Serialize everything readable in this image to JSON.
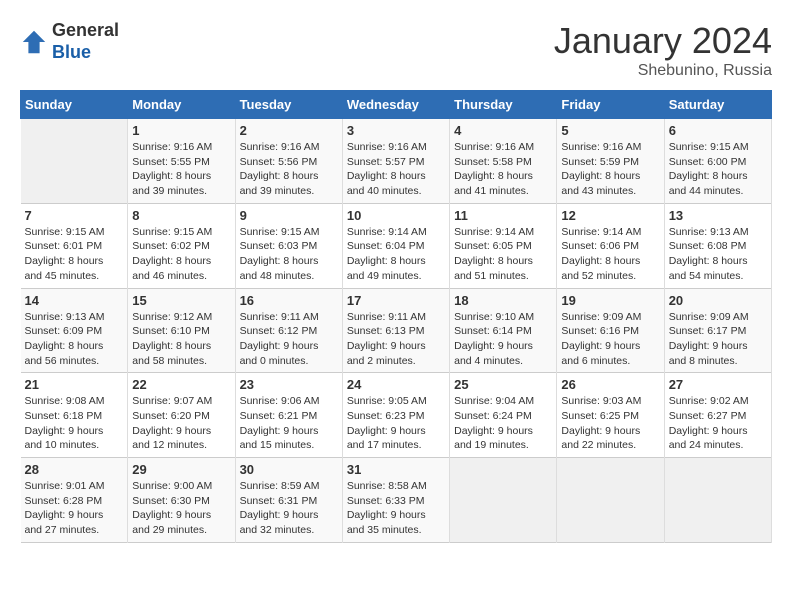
{
  "header": {
    "logo_line1": "General",
    "logo_line2": "Blue",
    "month": "January 2024",
    "location": "Shebunino, Russia"
  },
  "weekdays": [
    "Sunday",
    "Monday",
    "Tuesday",
    "Wednesday",
    "Thursday",
    "Friday",
    "Saturday"
  ],
  "weeks": [
    [
      {
        "num": "",
        "info": ""
      },
      {
        "num": "1",
        "info": "Sunrise: 9:16 AM\nSunset: 5:55 PM\nDaylight: 8 hours\nand 39 minutes."
      },
      {
        "num": "2",
        "info": "Sunrise: 9:16 AM\nSunset: 5:56 PM\nDaylight: 8 hours\nand 39 minutes."
      },
      {
        "num": "3",
        "info": "Sunrise: 9:16 AM\nSunset: 5:57 PM\nDaylight: 8 hours\nand 40 minutes."
      },
      {
        "num": "4",
        "info": "Sunrise: 9:16 AM\nSunset: 5:58 PM\nDaylight: 8 hours\nand 41 minutes."
      },
      {
        "num": "5",
        "info": "Sunrise: 9:16 AM\nSunset: 5:59 PM\nDaylight: 8 hours\nand 43 minutes."
      },
      {
        "num": "6",
        "info": "Sunrise: 9:15 AM\nSunset: 6:00 PM\nDaylight: 8 hours\nand 44 minutes."
      }
    ],
    [
      {
        "num": "7",
        "info": "Sunrise: 9:15 AM\nSunset: 6:01 PM\nDaylight: 8 hours\nand 45 minutes."
      },
      {
        "num": "8",
        "info": "Sunrise: 9:15 AM\nSunset: 6:02 PM\nDaylight: 8 hours\nand 46 minutes."
      },
      {
        "num": "9",
        "info": "Sunrise: 9:15 AM\nSunset: 6:03 PM\nDaylight: 8 hours\nand 48 minutes."
      },
      {
        "num": "10",
        "info": "Sunrise: 9:14 AM\nSunset: 6:04 PM\nDaylight: 8 hours\nand 49 minutes."
      },
      {
        "num": "11",
        "info": "Sunrise: 9:14 AM\nSunset: 6:05 PM\nDaylight: 8 hours\nand 51 minutes."
      },
      {
        "num": "12",
        "info": "Sunrise: 9:14 AM\nSunset: 6:06 PM\nDaylight: 8 hours\nand 52 minutes."
      },
      {
        "num": "13",
        "info": "Sunrise: 9:13 AM\nSunset: 6:08 PM\nDaylight: 8 hours\nand 54 minutes."
      }
    ],
    [
      {
        "num": "14",
        "info": "Sunrise: 9:13 AM\nSunset: 6:09 PM\nDaylight: 8 hours\nand 56 minutes."
      },
      {
        "num": "15",
        "info": "Sunrise: 9:12 AM\nSunset: 6:10 PM\nDaylight: 8 hours\nand 58 minutes."
      },
      {
        "num": "16",
        "info": "Sunrise: 9:11 AM\nSunset: 6:12 PM\nDaylight: 9 hours\nand 0 minutes."
      },
      {
        "num": "17",
        "info": "Sunrise: 9:11 AM\nSunset: 6:13 PM\nDaylight: 9 hours\nand 2 minutes."
      },
      {
        "num": "18",
        "info": "Sunrise: 9:10 AM\nSunset: 6:14 PM\nDaylight: 9 hours\nand 4 minutes."
      },
      {
        "num": "19",
        "info": "Sunrise: 9:09 AM\nSunset: 6:16 PM\nDaylight: 9 hours\nand 6 minutes."
      },
      {
        "num": "20",
        "info": "Sunrise: 9:09 AM\nSunset: 6:17 PM\nDaylight: 9 hours\nand 8 minutes."
      }
    ],
    [
      {
        "num": "21",
        "info": "Sunrise: 9:08 AM\nSunset: 6:18 PM\nDaylight: 9 hours\nand 10 minutes."
      },
      {
        "num": "22",
        "info": "Sunrise: 9:07 AM\nSunset: 6:20 PM\nDaylight: 9 hours\nand 12 minutes."
      },
      {
        "num": "23",
        "info": "Sunrise: 9:06 AM\nSunset: 6:21 PM\nDaylight: 9 hours\nand 15 minutes."
      },
      {
        "num": "24",
        "info": "Sunrise: 9:05 AM\nSunset: 6:23 PM\nDaylight: 9 hours\nand 17 minutes."
      },
      {
        "num": "25",
        "info": "Sunrise: 9:04 AM\nSunset: 6:24 PM\nDaylight: 9 hours\nand 19 minutes."
      },
      {
        "num": "26",
        "info": "Sunrise: 9:03 AM\nSunset: 6:25 PM\nDaylight: 9 hours\nand 22 minutes."
      },
      {
        "num": "27",
        "info": "Sunrise: 9:02 AM\nSunset: 6:27 PM\nDaylight: 9 hours\nand 24 minutes."
      }
    ],
    [
      {
        "num": "28",
        "info": "Sunrise: 9:01 AM\nSunset: 6:28 PM\nDaylight: 9 hours\nand 27 minutes."
      },
      {
        "num": "29",
        "info": "Sunrise: 9:00 AM\nSunset: 6:30 PM\nDaylight: 9 hours\nand 29 minutes."
      },
      {
        "num": "30",
        "info": "Sunrise: 8:59 AM\nSunset: 6:31 PM\nDaylight: 9 hours\nand 32 minutes."
      },
      {
        "num": "31",
        "info": "Sunrise: 8:58 AM\nSunset: 6:33 PM\nDaylight: 9 hours\nand 35 minutes."
      },
      {
        "num": "",
        "info": ""
      },
      {
        "num": "",
        "info": ""
      },
      {
        "num": "",
        "info": ""
      }
    ]
  ]
}
